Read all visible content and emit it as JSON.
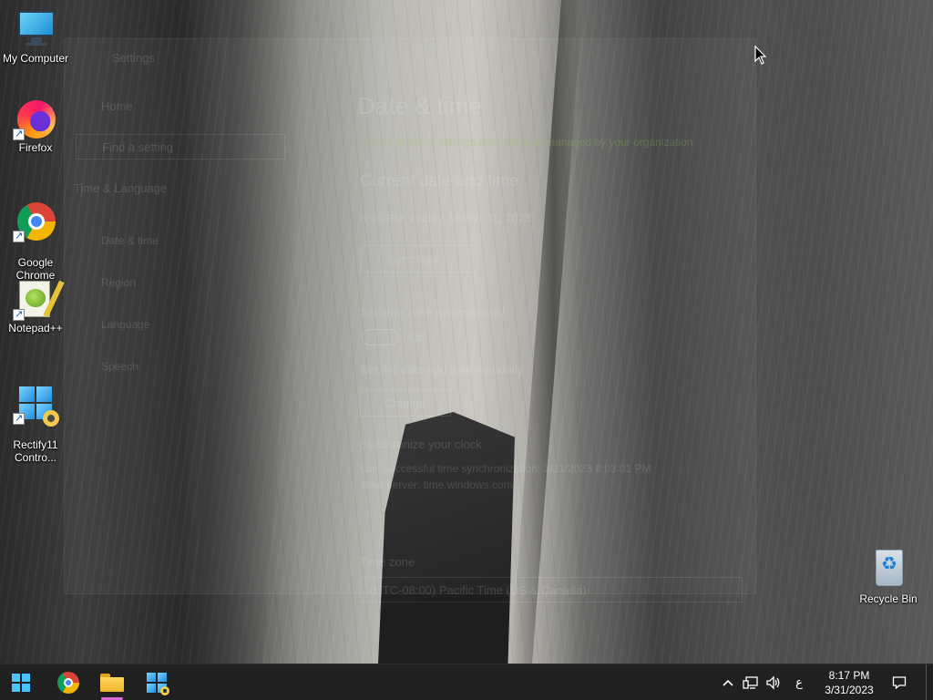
{
  "desktop": {
    "icons": [
      {
        "label": "My Computer"
      },
      {
        "label": "Firefox"
      },
      {
        "label": "Google\nChrome"
      },
      {
        "label": "Notepad++"
      },
      {
        "label": "Rectify11\nContro..."
      },
      {
        "label": "Recycle Bin"
      }
    ]
  },
  "settings_window": {
    "app_title": "Settings",
    "nav": {
      "home": "Home",
      "search_placeholder": "Find a setting",
      "section": "Time & Language",
      "items": [
        "Date & time",
        "Region",
        "Language",
        "Speech"
      ]
    },
    "page_title": "Date & time",
    "managed_notice": "*Some of these settings are hidden or managed by your organization.",
    "current_heading": "Current date and time",
    "current_value": "8:16 PM, Friday, March 31, 2023",
    "sync_now_label": "Sync now",
    "auto_timezone_label": "Set time zone automatically",
    "toggle_state": "Off",
    "manual_label": "Set the date and time manually",
    "change_label": "Change",
    "sync_heading": "Synchronize your clock",
    "sync_desc_1": "Last successful time synchronization: 3/31/2023 8:03:01 PM",
    "sync_desc_2": "Time server: time.windows.com",
    "timezone_heading": "Time zone",
    "timezone_value": "(UTC-08:00) Pacific Time (US & Canada)"
  },
  "taskbar": {
    "pinned": [
      "start",
      "chrome",
      "file-explorer",
      "rectify11-control"
    ],
    "ime": "ع",
    "clock_time": "8:17 PM",
    "clock_date": "3/31/2023"
  },
  "colors": {
    "taskbar_bg": "#202020",
    "start_blue": "#4cc2ff",
    "active_indicator": "#d86ad8"
  }
}
